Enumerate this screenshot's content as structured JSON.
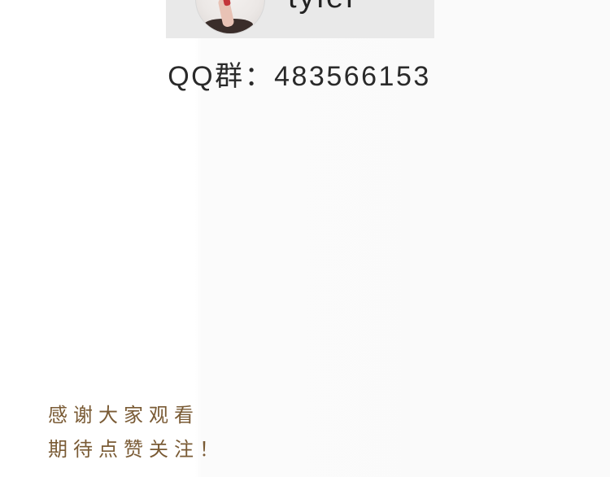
{
  "profile_card": {
    "name": "tyler",
    "avatar_icon": "person-illustration-icon"
  },
  "qq_group": {
    "text": "QQ群：483566153"
  },
  "closing": {
    "line1": "感谢大家观看",
    "line2": "期待点赞关注！"
  },
  "colors": {
    "card_bg": "#e9e9e9",
    "text_dark": "#2a2a2a",
    "closing_text": "#7a5b35"
  }
}
